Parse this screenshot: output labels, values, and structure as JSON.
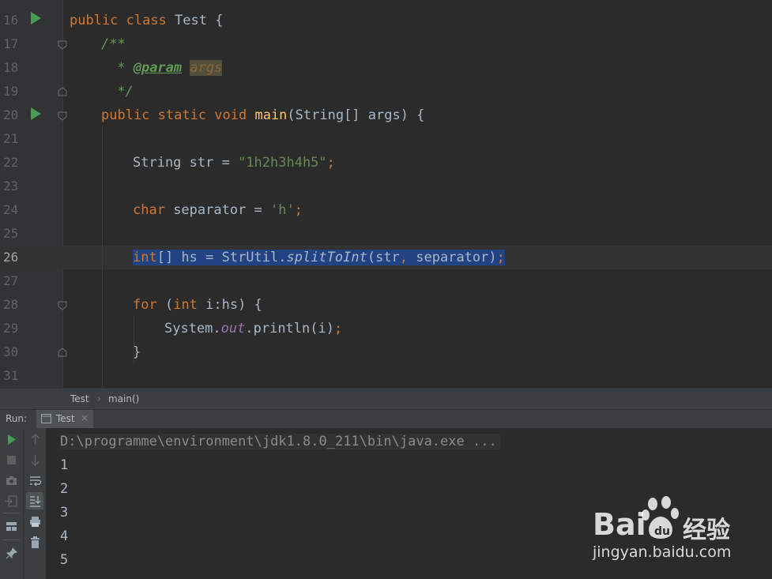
{
  "editor": {
    "lines": [
      {
        "n": "16",
        "html": "<span class='kw'>public class </span>Test {"
      },
      {
        "n": "17",
        "html": "<span class='doc'>/**</span>"
      },
      {
        "n": "18",
        "html": "<span class='doc'> * </span><span class='doctag'>@param</span><span class='doc'> </span><span class='docarg'>args</span>"
      },
      {
        "n": "19",
        "html": "<span class='doc'> */</span>"
      },
      {
        "n": "20",
        "html": "<span class='kw'>public static void </span><span class='fn'>main</span>(String[] args) {"
      },
      {
        "n": "21",
        "html": ""
      },
      {
        "n": "22",
        "html": "String str = <span class='str'>\"1h2h3h4h5\"</span><span class='kw'>;</span>"
      },
      {
        "n": "23",
        "html": ""
      },
      {
        "n": "24",
        "html": "<span class='kw'>char </span>separator = <span class='str'>'h'</span><span class='kw'>;</span>"
      },
      {
        "n": "25",
        "html": ""
      },
      {
        "n": "26",
        "html": "<span class='sel'><span class='kw'>int</span>[] hs = StrUtil.<span class='it'>splitToInt</span>(str<span class='kw'>, </span>separator)<span class='kw'>;</span></span>"
      },
      {
        "n": "27",
        "html": ""
      },
      {
        "n": "28",
        "html": "<span class='kw'>for </span>(<span class='kw'>int </span>i:hs) {"
      },
      {
        "n": "29",
        "html": "System.<span class='field'>out</span>.println(i)<span class='kw'>;</span>"
      },
      {
        "n": "30",
        "html": "}"
      },
      {
        "n": "31",
        "html": ""
      }
    ]
  },
  "breadcrumb": {
    "class_name": "Test",
    "method_name": "main()"
  },
  "run_panel": {
    "label": "Run:",
    "tab_label": "Test"
  },
  "console": {
    "command": "D:\\programme\\environment\\jdk1.8.0_211\\bin\\java.exe ...",
    "output": [
      "1",
      "2",
      "3",
      "4",
      "5"
    ]
  },
  "watermark": {
    "brand": "Bai",
    "brand_suffix": "经验",
    "url": "jingyan.baidu.com"
  },
  "colors": {
    "keyword": "#cc7832",
    "string": "#6a8759",
    "selection": "#214283",
    "run_green": "#499c54"
  }
}
